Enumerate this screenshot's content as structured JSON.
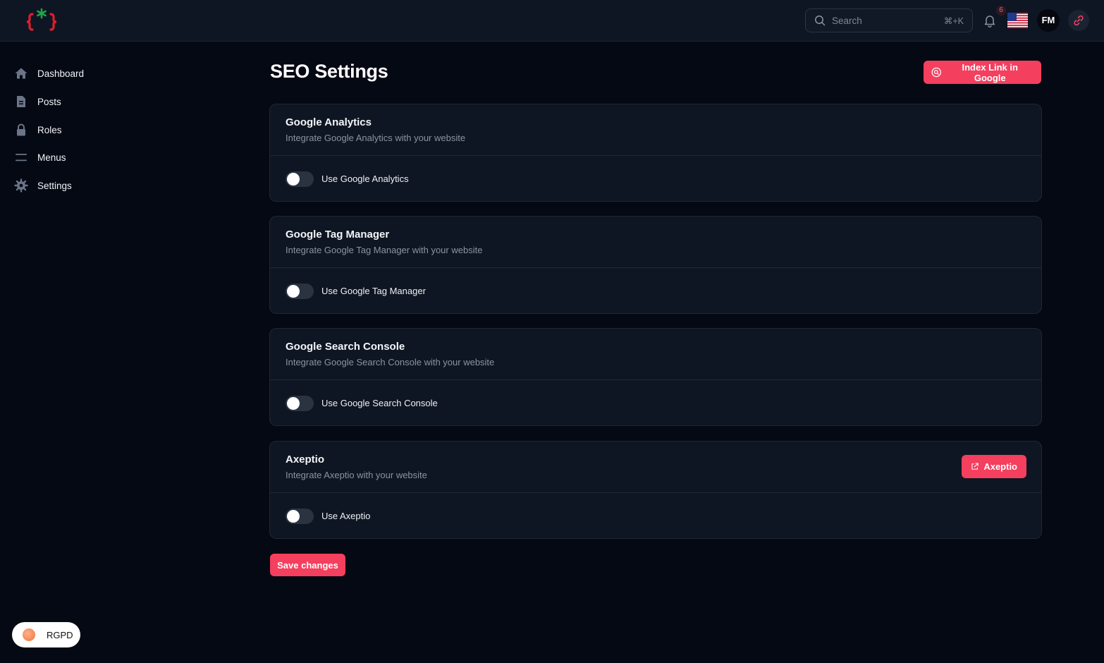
{
  "header": {
    "logo_icon": "curly-braces-asterisk-logo",
    "search": {
      "placeholder": "Search",
      "shortcut": "⌘+K"
    },
    "notifications": {
      "count": "6",
      "icon": "bell-icon"
    },
    "language_flag": "us-flag-icon",
    "user_initials": "FM",
    "link_icon": "link-icon"
  },
  "sidebar": {
    "items": [
      {
        "label": "Dashboard",
        "icon": "home-icon"
      },
      {
        "label": "Posts",
        "icon": "document-icon"
      },
      {
        "label": "Roles",
        "icon": "lock-icon"
      },
      {
        "label": "Menus",
        "icon": "menu-icon"
      },
      {
        "label": "Settings",
        "icon": "gear-icon"
      }
    ],
    "cookie_button": "RGPD"
  },
  "main": {
    "title": "SEO Settings",
    "index_button": "Index Link in Google",
    "cards": [
      {
        "title": "Google Analytics",
        "description": "Integrate Google Analytics with your website",
        "toggle_label": "Use Google Analytics",
        "enabled": false
      },
      {
        "title": "Google Tag Manager",
        "description": "Integrate Google Tag Manager with your website",
        "toggle_label": "Use Google Tag Manager",
        "enabled": false
      },
      {
        "title": "Google Search Console",
        "description": "Integrate Google Search Console with your website",
        "toggle_label": "Use Google Search Console",
        "enabled": false
      },
      {
        "title": "Axeptio",
        "description": "Integrate Axeptio with your website",
        "toggle_label": "Use Axeptio",
        "enabled": false,
        "action_button": "Axeptio"
      }
    ],
    "save_button": "Save changes"
  },
  "colors": {
    "accent": "#f43f5e",
    "background": "#050914",
    "surface": "#0f1623",
    "border": "#1f2735"
  }
}
